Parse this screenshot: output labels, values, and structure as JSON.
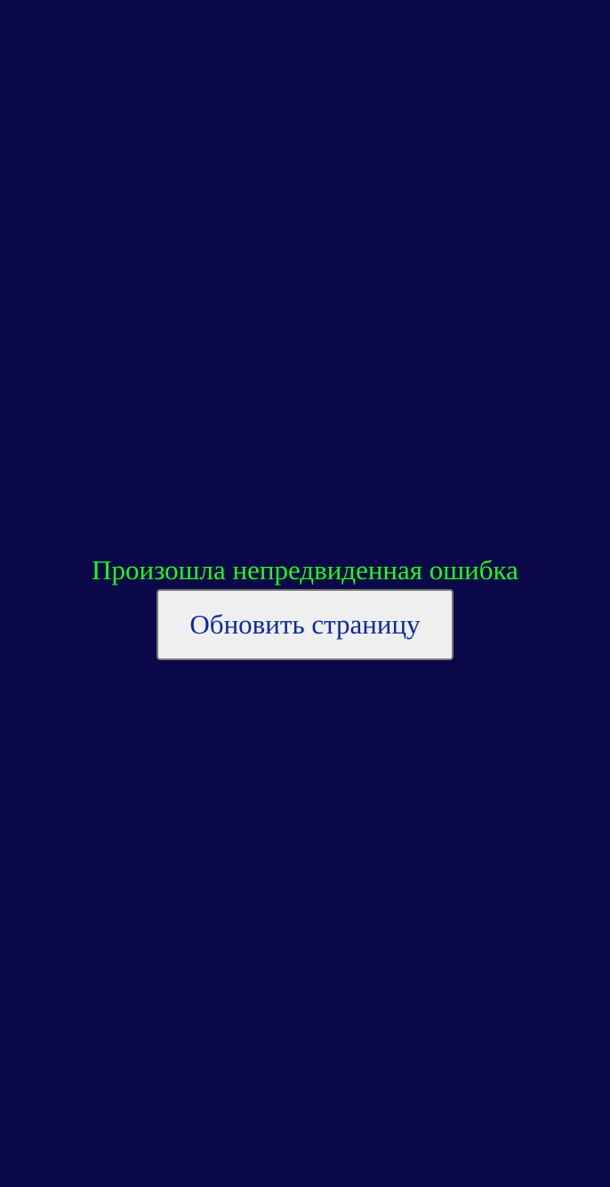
{
  "colors": {
    "background": "#0a0848",
    "error_text": "#1aff1a",
    "button_background": "#efefef",
    "button_text": "#0a2a9e",
    "button_border": "#767676"
  },
  "error": {
    "message": "Произошла непредвиденная ошибка"
  },
  "actions": {
    "reload_label": "Обновить страницу"
  }
}
